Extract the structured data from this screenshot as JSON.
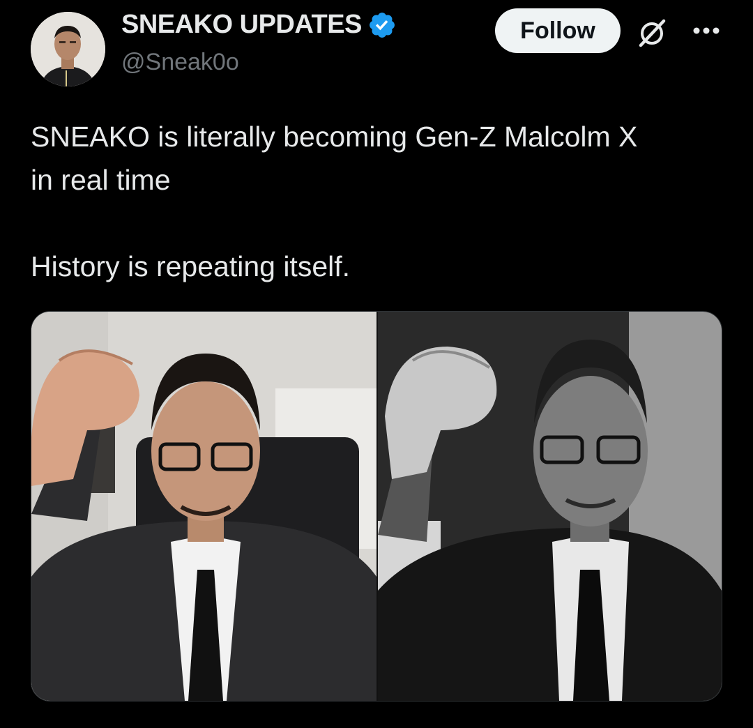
{
  "account": {
    "display_name": "SNEAKO UPDATES",
    "handle": "@Sneak0o",
    "verified_icon": "verified-badge-icon",
    "avatar_icon": "avatar-photo"
  },
  "actions": {
    "follow_label": "Follow",
    "grok_icon": "grok-icon",
    "more_icon": "more-dots-icon"
  },
  "tweet": {
    "line1": "SNEAKO is literally becoming Gen-Z Malcolm X",
    "line2": "in real time",
    "line3": "History is repeating itself."
  },
  "media": {
    "left_photo": "man-raised-fist-color-photo",
    "right_photo": "man-raised-fist-black-and-white-photo"
  },
  "colors": {
    "background": "#000000",
    "text": "#e7e9ea",
    "secondary_text": "#71767b",
    "verified_blue": "#1d9bf0",
    "follow_button_bg": "#eff3f4"
  }
}
